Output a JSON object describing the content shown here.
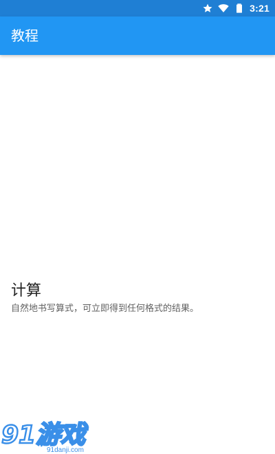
{
  "status_bar": {
    "time": "3:21",
    "icons": [
      "star-icon",
      "wifi-icon",
      "battery-icon"
    ],
    "background": "#1f7fd4"
  },
  "app_bar": {
    "title": "教程",
    "background": "#2196f3"
  },
  "feature": {
    "title": "计算",
    "description": "自然地书写算式，可立即得到任何格式的结果。"
  },
  "watermark": {
    "logo_text": "91游戏",
    "url": "91danji.com",
    "color": "#3a8fe8"
  }
}
